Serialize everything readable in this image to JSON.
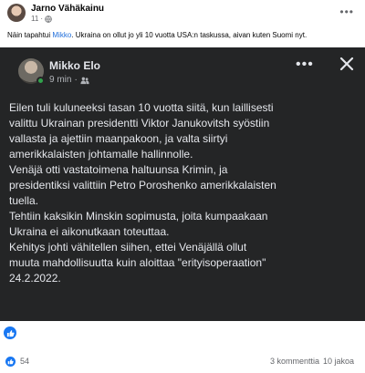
{
  "post": {
    "author": "Jarno Vähäkainu",
    "time": "11",
    "text_before": "Näin tapahtui ",
    "mention": "Mikko",
    "text_after": ". Ukraina on ollut jo yli 10 vuotta USA:n taskussa, aivan kuten Suomi nyt."
  },
  "shared": {
    "name": "Mikko Elo",
    "time": "9 min",
    "separator": "·",
    "lines": [
      "Eilen tuli kuluneeksi tasan 10 vuotta siitä, kun laillisesti",
      "valittu Ukrainan presidentti Viktor Janukovitsh syöstiin",
      "vallasta ja ajettiin maanpakoon, ja valta siirtyi",
      "amerikkalaisten johtamalle hallinnolle.",
      "Venäjä otti vastatoimena haltuunsa Krimin, ja",
      "presidentiksi valittiin Petro Poroshenko amerikkalaisten",
      "tuella.",
      "Tehtiin kaksikin Minskin sopimusta, joita kumpaakaan",
      "Ukraina ei aikonutkaan toteuttaa.",
      "Kehitys johti vähitellen siihen, ettei Venäjällä ollut",
      "muuta mahdollisuutta kuin aloittaa \"erityisoperaation\"",
      "24.2.2022."
    ]
  },
  "stats": {
    "likes": "54",
    "comments": "3 kommenttia",
    "shares": "10 jakoa"
  },
  "icons": {
    "globe": "globe-icon",
    "people": "people-icon",
    "like": "like-icon",
    "more": "more-icon",
    "close": "close-icon"
  },
  "colors": {
    "card_bg": "#242526",
    "accent": "#1877f2",
    "online": "#31a24c",
    "mention": "#216fdb"
  }
}
